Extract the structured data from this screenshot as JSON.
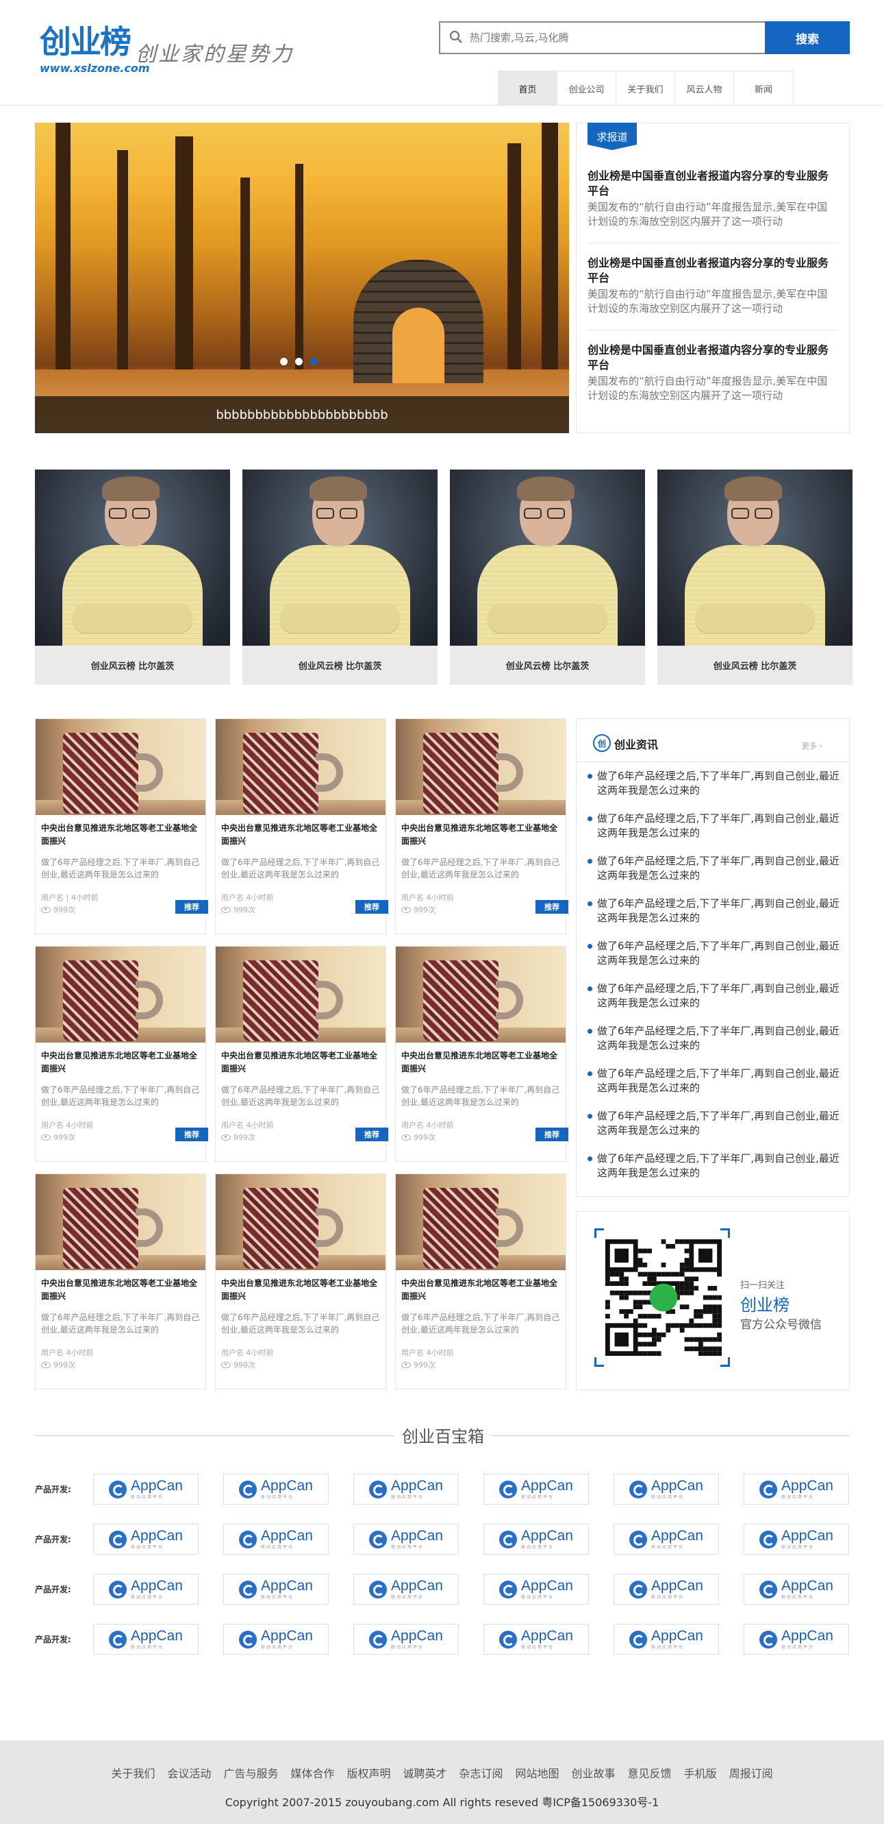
{
  "header": {
    "logo_text": "创业榜",
    "logo_url": "www.xslzone.com",
    "slogan": "创业家的星势力",
    "search_placeholder": "热门搜索,马云,马化腾",
    "search_button": "搜索"
  },
  "nav": {
    "items": [
      "首页",
      "创业公司",
      "关于我们",
      "风云人物",
      "新闻"
    ],
    "active": "首页"
  },
  "slider": {
    "caption": "bbbbbbbbbbbbbbbbbbbbbb",
    "slide_count": 3,
    "active_slide": 3
  },
  "reports": {
    "tag": "求报道",
    "items": [
      {
        "title": "创业榜是中国垂直创业者报道内容分享的专业服务平台",
        "desc": "美国发布的“航行自由行动”年度报告显示,美军在中国计划设的东海放空别区内展开了这一项行动"
      },
      {
        "title": "创业榜是中国垂直创业者报道内容分享的专业服务平台",
        "desc": "美国发布的“航行自由行动”年度报告显示,美军在中国计划设的东海放空别区内展开了这一项行动"
      },
      {
        "title": "创业榜是中国垂直创业者报道内容分享的专业服务平台",
        "desc": "美国发布的“航行自由行动”年度报告显示,美军在中国计划设的东海放空别区内展开了这一项行动"
      }
    ]
  },
  "people": [
    {
      "name": "创业风云榜 比尔盖茨"
    },
    {
      "name": "创业风云榜 比尔盖茨"
    },
    {
      "name": "创业风云榜 比尔盖茨"
    },
    {
      "name": "创业风云榜 比尔盖茨"
    }
  ],
  "articles": [
    {
      "title": "中央出台意见推进东北地区等老工业基地全面振兴",
      "desc": "做了6年产品经理之后,下了半年厂,再到自己创业,最近这两年我是怎么过来的",
      "meta": "用户名 | 4小时前",
      "views": "999次",
      "badge": "推荐"
    },
    {
      "title": "中央出台意见推进东北地区等老工业基地全面振兴",
      "desc": "做了6年产品经理之后,下了半年厂,再到自己创业,最近这两年我是怎么过来的",
      "meta": "用户名 4小时前",
      "views": "999次",
      "badge": "推荐"
    },
    {
      "title": "中央出台意见推进东北地区等老工业基地全面振兴",
      "desc": "做了6年产品经理之后,下了半年厂,再到自己创业,最近这两年我是怎么过来的",
      "meta": "用户名 4小时前",
      "views": "999次",
      "badge": "推荐"
    },
    {
      "title": "中央出台意见推进东北地区等老工业基地全面振兴",
      "desc": "做了6年产品经理之后,下了半年厂,再到自己创业,最近这两年我是怎么过来的",
      "meta": "用户名 4小时前",
      "views": "999次",
      "badge": "推荐"
    },
    {
      "title": "中央出台意见推进东北地区等老工业基地全面振兴",
      "desc": "做了6年产品经理之后,下了半年厂,再到自己创业,最近这两年我是怎么过来的",
      "meta": "用户名 4小时前",
      "views": "999次",
      "badge": "推荐"
    },
    {
      "title": "中央出台意见推进东北地区等老工业基地全面振兴",
      "desc": "做了6年产品经理之后,下了半年厂,再到自己创业,最近这两年我是怎么过来的",
      "meta": "用户名 4小时前",
      "views": "999次",
      "badge": "推荐"
    },
    {
      "title": "中央出台意见推进东北地区等老工业基地全面振兴",
      "desc": "做了6年产品经理之后,下了半年厂,再到自己创业,最近这两年我是怎么过来的",
      "meta": "用户名 4小时前",
      "views": "999次",
      "badge": ""
    },
    {
      "title": "中央出台意见推进东北地区等老工业基地全面振兴",
      "desc": "做了6年产品经理之后,下了半年厂,再到自己创业,最近这两年我是怎么过来的",
      "meta": "用户名 4小时前",
      "views": "999次",
      "badge": ""
    },
    {
      "title": "中央出台意见推进东北地区等老工业基地全面振兴",
      "desc": "做了6年产品经理之后,下了半年厂,再到自己创业,最近这两年我是怎么过来的",
      "meta": "用户名 4小时前",
      "views": "999次",
      "badge": ""
    }
  ],
  "news": {
    "icon_text": "创",
    "title": "创业资讯",
    "more": "更多",
    "items": [
      "做了6年产品经理之后,下了半年厂,再到自己创业,最近这两年我是怎么过来的",
      "做了6年产品经理之后,下了半年厂,再到自己创业,最近这两年我是怎么过来的",
      "做了6年产品经理之后,下了半年厂,再到自己创业,最近这两年我是怎么过来的",
      "做了6年产品经理之后,下了半年厂,再到自己创业,最近这两年我是怎么过来的",
      "做了6年产品经理之后,下了半年厂,再到自己创业,最近这两年我是怎么过来的",
      "做了6年产品经理之后,下了半年厂,再到自己创业,最近这两年我是怎么过来的",
      "做了6年产品经理之后,下了半年厂,再到自己创业,最近这两年我是怎么过来的",
      "做了6年产品经理之后,下了半年厂,再到自己创业,最近这两年我是怎么过来的",
      "做了6年产品经理之后,下了半年厂,再到自己创业,最近这两年我是怎么过来的",
      "做了6年产品经理之后,下了半年厂,再到自己创业,最近这两年我是怎么过来的"
    ]
  },
  "wechat": {
    "scan_text": "扫一扫关注",
    "name": "创业榜",
    "desc": "官方公众号微信"
  },
  "toolbox": {
    "title": "创业百宝箱",
    "row_label": "产品开发:",
    "rows": 4,
    "per_row": 6,
    "logo_word": "AppCan",
    "logo_sub": "移动应用平台"
  },
  "footer": {
    "links": [
      "关于我们",
      "会议活动",
      "广告与服务",
      "媒体合作",
      "版权声明",
      "诚聘英才",
      "杂志订阅",
      "网站地图",
      "创业故事",
      "意见反馈",
      "手机版",
      "周报订阅"
    ],
    "copyright": "Copyright 2007-2015 zouyoubang.com All rights reseved 粤ICP备15069330号-1"
  },
  "colors": {
    "accent": "#1566c0",
    "footer_bg": "#e6e6e6"
  }
}
